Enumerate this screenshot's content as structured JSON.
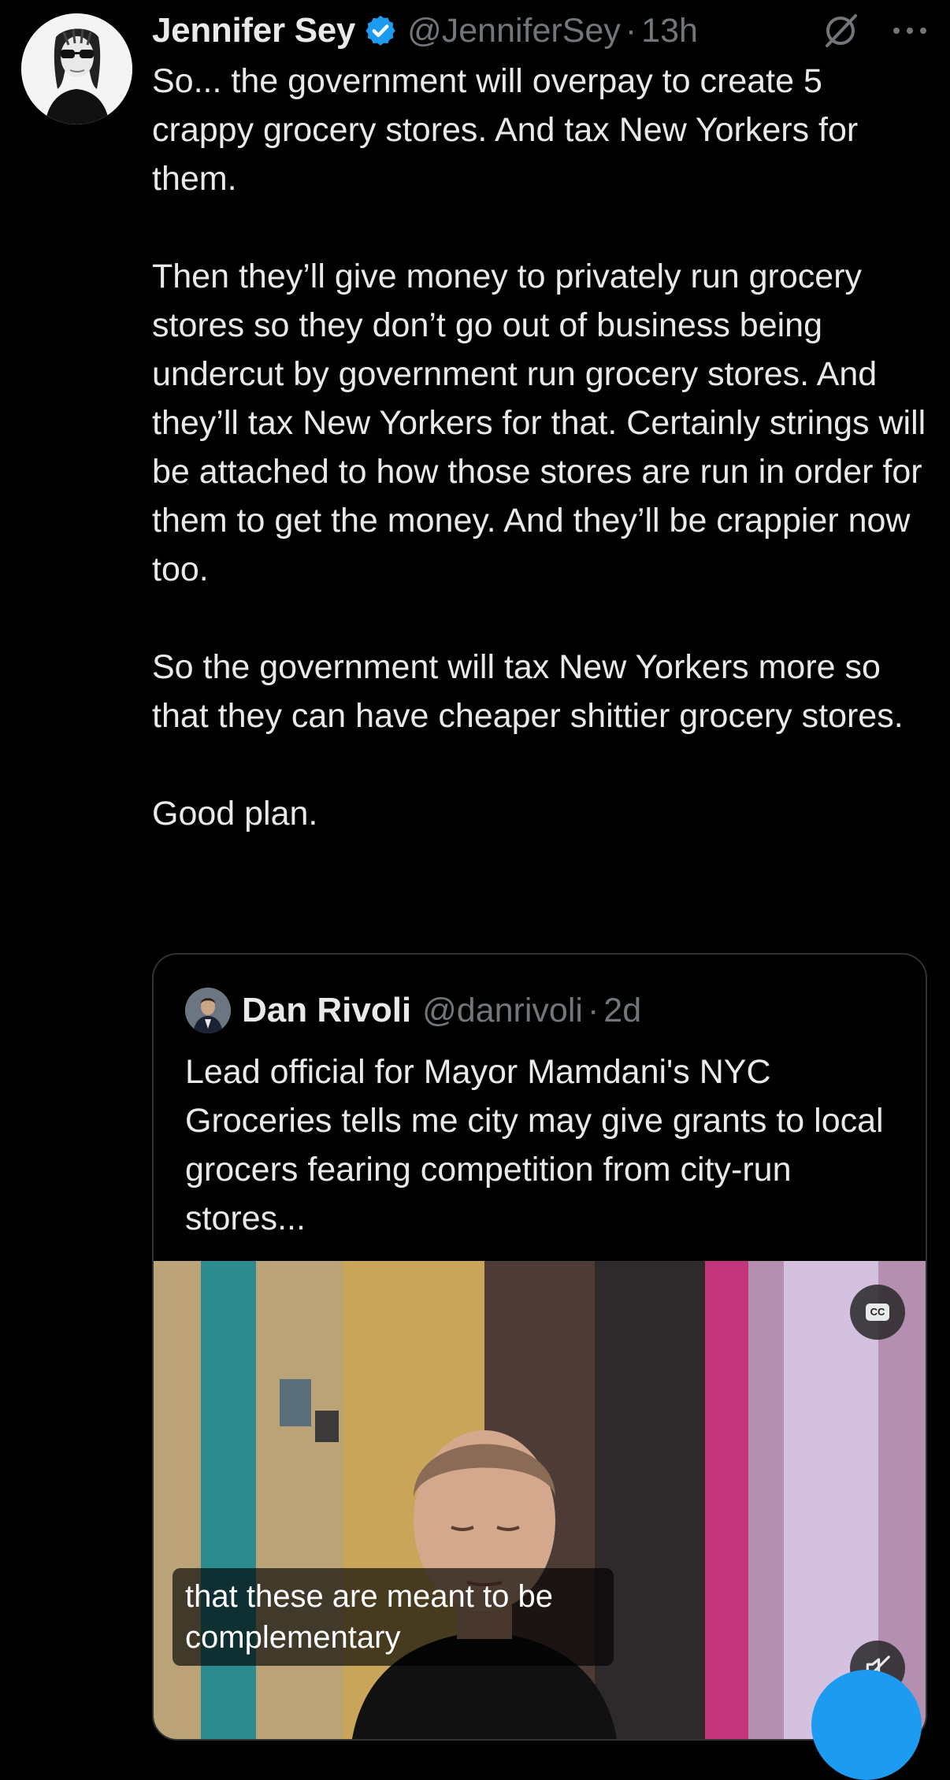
{
  "post": {
    "author": {
      "display_name": "Jennifer Sey",
      "handle": "@JenniferSey",
      "time": "13h",
      "verified": true
    },
    "paragraphs": [
      "So... the government will overpay to create 5 crappy grocery stores. And tax New Yorkers for them.",
      "Then they’ll give money to privately run grocery stores so they don’t go out of business being undercut by government run grocery stores. And they’ll tax New Yorkers for that. Certainly strings will be attached to how those stores are run in order for them to get the money. And they’ll be crappier now too.",
      "So the government will tax New Yorkers more so that they can have cheaper shittier grocery stores.",
      "Good plan."
    ]
  },
  "quote": {
    "author": {
      "display_name": "Dan Rivoli",
      "handle": "@danrivoli",
      "time": "2d"
    },
    "text": "Lead official for Mayor Mamdani's NYC Groceries tells me city may give grants to local grocers fearing competition from city-run stores...",
    "video": {
      "caption": "that these are meant to be complementary",
      "cc_label": "CC"
    }
  },
  "icons": {
    "verified": "verified-badge-icon",
    "grok": "grok-icon",
    "more": "more-options-icon",
    "cc": "closed-captions-icon",
    "mute": "muted-speaker-icon",
    "compose": "compose-fab"
  },
  "colors": {
    "background": "#000000",
    "text": "#e7e9ea",
    "muted": "#71767b",
    "accent": "#1d9bf0",
    "border": "#2f3336"
  }
}
